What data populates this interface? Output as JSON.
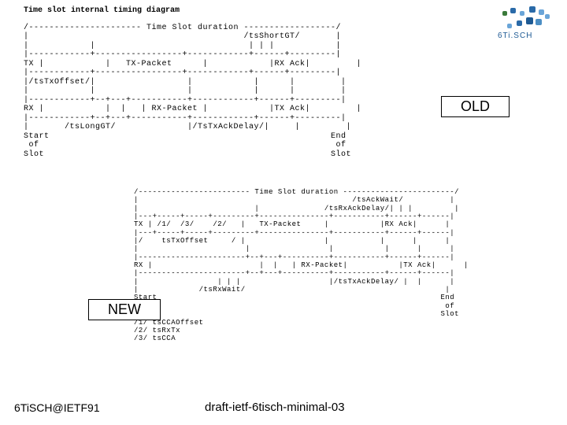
{
  "title": "Time slot internal timing diagram",
  "labels": {
    "old": "OLD",
    "new": "NEW"
  },
  "footer": {
    "left": "6TiSCH@IETF91",
    "center": "draft-ietf-6tisch-minimal-03"
  },
  "old_diagram": "/---------------------- Time Slot duration ------------------/\n|                                          /tsShortGT/       |\n|            |                              | | |            |\n|------------+-----------------+------------+------+---------|\nTX |            |   TX-Packet      |            |RX Ack|         |\n|------------+-----------------+------------+------+---------|\n|/tsTxOffset/|                  |            |      |         |\n|            |                  |            |      |         |\n|------------+--+---+-----------+------------+------+---------|\nRX |            |  |   | RX-Packet |            |TX Ack|         |\n|------------+--+---+-----------+------------+------+---------|\n|       /tsLongGT/              |/TsTxAckDelay/|     |         |\nStart                                                       End\n of                                                          of\nSlot                                                        Slot",
  "new_diagram": "/------------------------ Time Slot duration ------------------------/\n|                                              /tsAckWait/          |\n|                         |              /tsRxAckDelay/| | |         |\n|---+-----+-----+---------+---------------+-----------+------+------|\nTX | /1/  /3/    /2/   |   TX-Packet     |           |RX Ack|      |\n|---+-----+-----+---------+---------------+-----------+------+------|\n|/    tsTxOffset     / |                 |           |      |      |\n|                       |                 |           |      |      |\n|-----------------------+--+---+----------+-----------+------+------|\nRX |                       |  |   | RX-Packet|           |TX Ack|      |\n|-----------------------+--+---+----------+-----------+------+------|\n|                 | | |                   |/tsTxAckDelay/ |  |      |\n|             /tsRxWait/                                           |\nStart                                                             End\n of                                                                of\nSlot                                                              Slot\n/1/ tsCCAOffset\n/2/ tsRxTx\n/3/ tsCCA"
}
